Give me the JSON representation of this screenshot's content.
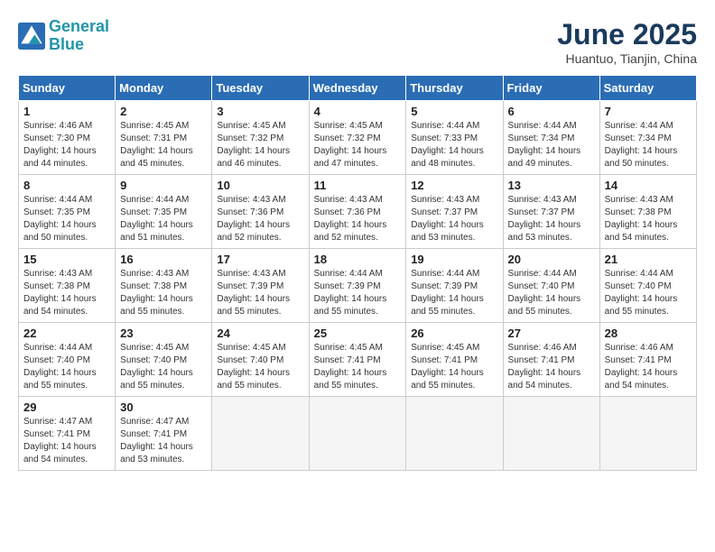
{
  "logo": {
    "line1": "General",
    "line2": "Blue"
  },
  "title": "June 2025",
  "subtitle": "Huantuo, Tianjin, China",
  "weekdays": [
    "Sunday",
    "Monday",
    "Tuesday",
    "Wednesday",
    "Thursday",
    "Friday",
    "Saturday"
  ],
  "weeks": [
    [
      {
        "day": 1,
        "info": "Sunrise: 4:46 AM\nSunset: 7:30 PM\nDaylight: 14 hours\nand 44 minutes."
      },
      {
        "day": 2,
        "info": "Sunrise: 4:45 AM\nSunset: 7:31 PM\nDaylight: 14 hours\nand 45 minutes."
      },
      {
        "day": 3,
        "info": "Sunrise: 4:45 AM\nSunset: 7:32 PM\nDaylight: 14 hours\nand 46 minutes."
      },
      {
        "day": 4,
        "info": "Sunrise: 4:45 AM\nSunset: 7:32 PM\nDaylight: 14 hours\nand 47 minutes."
      },
      {
        "day": 5,
        "info": "Sunrise: 4:44 AM\nSunset: 7:33 PM\nDaylight: 14 hours\nand 48 minutes."
      },
      {
        "day": 6,
        "info": "Sunrise: 4:44 AM\nSunset: 7:34 PM\nDaylight: 14 hours\nand 49 minutes."
      },
      {
        "day": 7,
        "info": "Sunrise: 4:44 AM\nSunset: 7:34 PM\nDaylight: 14 hours\nand 50 minutes."
      }
    ],
    [
      {
        "day": 8,
        "info": "Sunrise: 4:44 AM\nSunset: 7:35 PM\nDaylight: 14 hours\nand 50 minutes."
      },
      {
        "day": 9,
        "info": "Sunrise: 4:44 AM\nSunset: 7:35 PM\nDaylight: 14 hours\nand 51 minutes."
      },
      {
        "day": 10,
        "info": "Sunrise: 4:43 AM\nSunset: 7:36 PM\nDaylight: 14 hours\nand 52 minutes."
      },
      {
        "day": 11,
        "info": "Sunrise: 4:43 AM\nSunset: 7:36 PM\nDaylight: 14 hours\nand 52 minutes."
      },
      {
        "day": 12,
        "info": "Sunrise: 4:43 AM\nSunset: 7:37 PM\nDaylight: 14 hours\nand 53 minutes."
      },
      {
        "day": 13,
        "info": "Sunrise: 4:43 AM\nSunset: 7:37 PM\nDaylight: 14 hours\nand 53 minutes."
      },
      {
        "day": 14,
        "info": "Sunrise: 4:43 AM\nSunset: 7:38 PM\nDaylight: 14 hours\nand 54 minutes."
      }
    ],
    [
      {
        "day": 15,
        "info": "Sunrise: 4:43 AM\nSunset: 7:38 PM\nDaylight: 14 hours\nand 54 minutes."
      },
      {
        "day": 16,
        "info": "Sunrise: 4:43 AM\nSunset: 7:38 PM\nDaylight: 14 hours\nand 55 minutes."
      },
      {
        "day": 17,
        "info": "Sunrise: 4:43 AM\nSunset: 7:39 PM\nDaylight: 14 hours\nand 55 minutes."
      },
      {
        "day": 18,
        "info": "Sunrise: 4:44 AM\nSunset: 7:39 PM\nDaylight: 14 hours\nand 55 minutes."
      },
      {
        "day": 19,
        "info": "Sunrise: 4:44 AM\nSunset: 7:39 PM\nDaylight: 14 hours\nand 55 minutes."
      },
      {
        "day": 20,
        "info": "Sunrise: 4:44 AM\nSunset: 7:40 PM\nDaylight: 14 hours\nand 55 minutes."
      },
      {
        "day": 21,
        "info": "Sunrise: 4:44 AM\nSunset: 7:40 PM\nDaylight: 14 hours\nand 55 minutes."
      }
    ],
    [
      {
        "day": 22,
        "info": "Sunrise: 4:44 AM\nSunset: 7:40 PM\nDaylight: 14 hours\nand 55 minutes."
      },
      {
        "day": 23,
        "info": "Sunrise: 4:45 AM\nSunset: 7:40 PM\nDaylight: 14 hours\nand 55 minutes."
      },
      {
        "day": 24,
        "info": "Sunrise: 4:45 AM\nSunset: 7:40 PM\nDaylight: 14 hours\nand 55 minutes."
      },
      {
        "day": 25,
        "info": "Sunrise: 4:45 AM\nSunset: 7:41 PM\nDaylight: 14 hours\nand 55 minutes."
      },
      {
        "day": 26,
        "info": "Sunrise: 4:45 AM\nSunset: 7:41 PM\nDaylight: 14 hours\nand 55 minutes."
      },
      {
        "day": 27,
        "info": "Sunrise: 4:46 AM\nSunset: 7:41 PM\nDaylight: 14 hours\nand 54 minutes."
      },
      {
        "day": 28,
        "info": "Sunrise: 4:46 AM\nSunset: 7:41 PM\nDaylight: 14 hours\nand 54 minutes."
      }
    ],
    [
      {
        "day": 29,
        "info": "Sunrise: 4:47 AM\nSunset: 7:41 PM\nDaylight: 14 hours\nand 54 minutes."
      },
      {
        "day": 30,
        "info": "Sunrise: 4:47 AM\nSunset: 7:41 PM\nDaylight: 14 hours\nand 53 minutes."
      },
      {
        "day": null,
        "info": ""
      },
      {
        "day": null,
        "info": ""
      },
      {
        "day": null,
        "info": ""
      },
      {
        "day": null,
        "info": ""
      },
      {
        "day": null,
        "info": ""
      }
    ]
  ]
}
